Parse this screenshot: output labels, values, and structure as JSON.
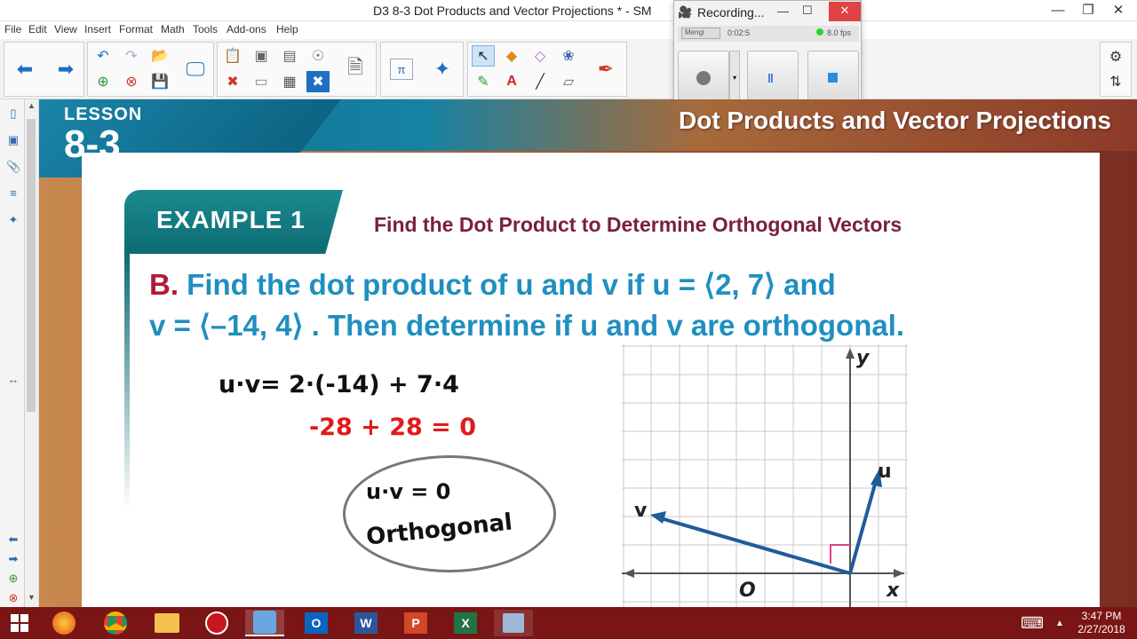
{
  "window": {
    "title": "D3 8-3 Dot Products and Vector Projections * - SM",
    "minimize": "—",
    "maximize": "❐",
    "close": "✕"
  },
  "menu": [
    "File",
    "Edit",
    "View",
    "Insert",
    "Format",
    "Math",
    "Tools",
    "Add-ons",
    "Help"
  ],
  "recorder": {
    "title": "Recording...",
    "minimize": "—",
    "maximize": "☐",
    "close": "✕",
    "source": "Mengi",
    "time": "0:02:5",
    "fps": "8.0 fps"
  },
  "slide": {
    "lesson_label": "LESSON",
    "lesson_number": "8-3",
    "title": "Dot Products and Vector Projections",
    "example_label": "EXAMPLE 1",
    "example_heading": "Find the Dot Product to Determine Orthogonal Vectors",
    "part": "B.",
    "problem_line1": "Find the dot product of u and v if u = ⟨2, 7⟩ and",
    "problem_line2": "v = ⟨–14, 4⟩ . Then determine if u and v are orthogonal.",
    "work_line1": "u·v= 2·(-14) + 7·4",
    "work_line2": "-28 + 28 = 0",
    "circle_line1": "u·v = 0",
    "circle_line2": "Orthogonal",
    "graph": {
      "y_label": "y",
      "x_label": "x",
      "origin_label": "O",
      "u_label": "u",
      "v_label": "v"
    }
  },
  "clock": {
    "time": "3:47 PM",
    "date": "2/27/2018"
  },
  "colors": {
    "accent_blue": "#1f8fc0",
    "heading_red": "#7a1f3d",
    "taskbar": "#7a1515",
    "vector": "#1f5c99",
    "handwriting_red": "#e01b1b"
  }
}
